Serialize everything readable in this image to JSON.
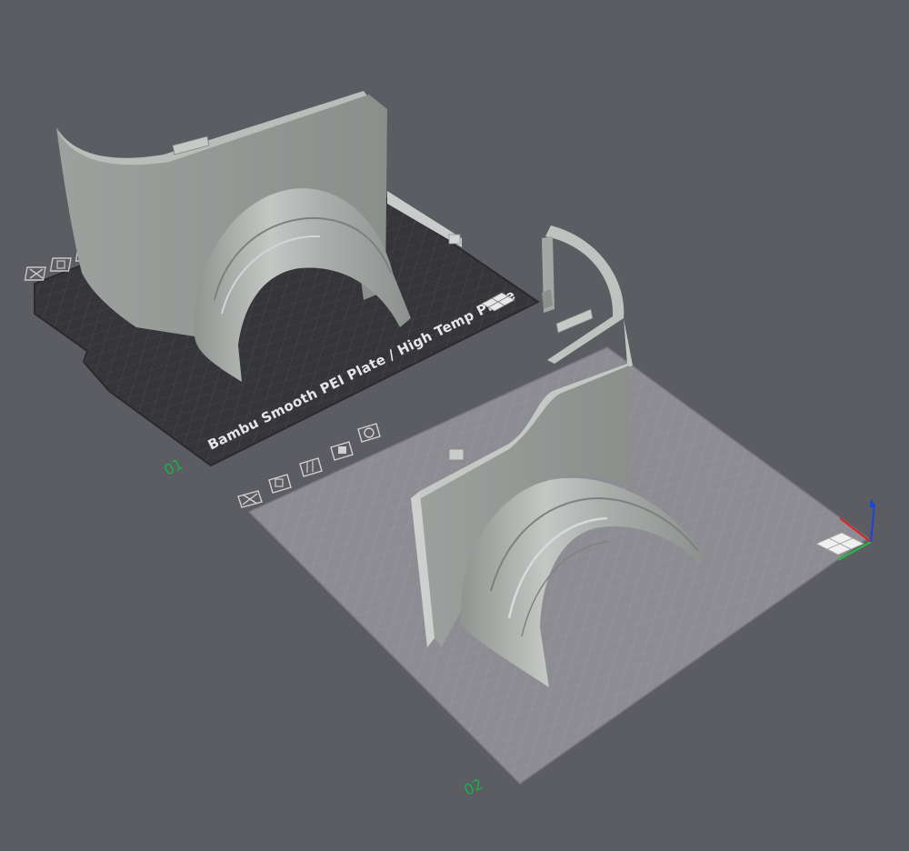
{
  "viewport": {
    "background": "#5c5c63",
    "plates": [
      {
        "id": "plate-1",
        "label": "Bambu Smooth PEI Plate / High Temp Plate",
        "number": "01",
        "surface_color": "#35353a",
        "toolbar_icons": [
          "close-icon",
          "auto-orient-icon",
          "arrange-icon"
        ],
        "corner_icon": "plate-grid-icon"
      },
      {
        "id": "plate-2",
        "number": "02",
        "surface_color": "#8c8c92",
        "toolbar_icons": [
          "close-icon",
          "auto-orient-icon",
          "arrange-icon",
          "lock-icon",
          "settings-icon"
        ],
        "corner_icon": "plate-grid-icon",
        "active": true
      }
    ],
    "model": {
      "name": "fender-cover",
      "color": "#a7aca9"
    },
    "axes": {
      "x_color": "#e02020",
      "y_color": "#20c040",
      "z_color": "#2040e0"
    }
  }
}
